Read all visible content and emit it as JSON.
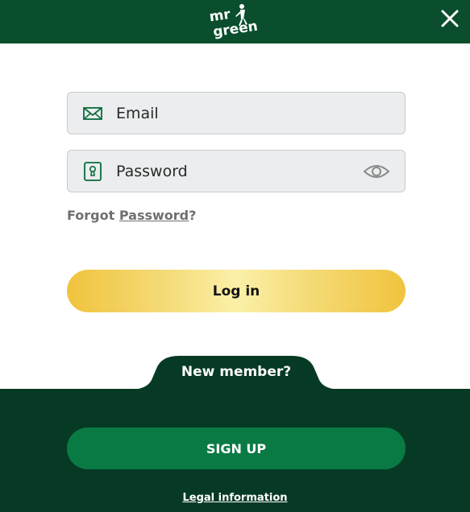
{
  "header": {
    "logo_line1": "mr",
    "logo_line2": "green",
    "close_icon": "close-icon"
  },
  "form": {
    "email": {
      "placeholder": "Email",
      "value": "",
      "icon": "envelope-icon"
    },
    "password": {
      "placeholder": "Password",
      "value": "",
      "icon": "keyhole-icon",
      "toggle_icon": "eye-icon"
    },
    "forgot_prefix": "Forgot",
    "forgot_link": "Password",
    "forgot_suffix": "?",
    "login_label": "Log in"
  },
  "footer": {
    "new_member_label": "New member?",
    "signup_label": "SIGN UP",
    "legal_link": "Legal information"
  },
  "colors": {
    "brand_green": "#0a4e2e",
    "footer_green": "#063a24",
    "signup_green": "#0a7a45",
    "login_gold": "#f0c33d"
  }
}
